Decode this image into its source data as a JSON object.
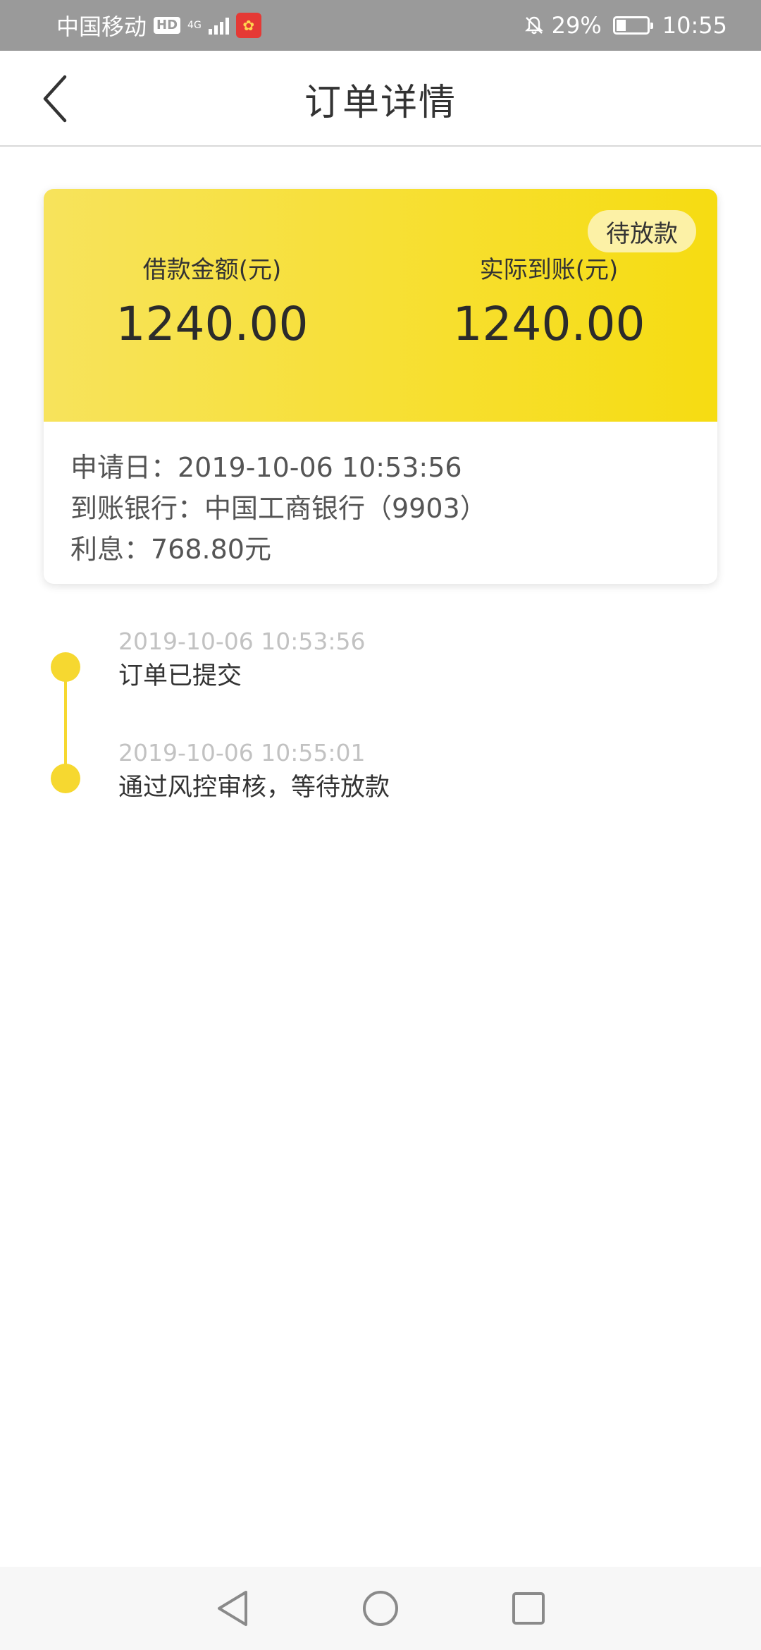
{
  "status_bar": {
    "carrier": "中国移动",
    "hd": "HD",
    "network": "4G",
    "battery_percent": "29%",
    "battery_level": 0.29,
    "time": "10:55"
  },
  "header": {
    "title": "订单详情"
  },
  "order_card": {
    "status_badge": "待放款",
    "loan_amount_label": "借款金额(元)",
    "loan_amount_value": "1240.00",
    "received_amount_label": "实际到账(元)",
    "received_amount_value": "1240.00",
    "apply_date": "申请日：2019-10-06 10:53:56",
    "bank": "到账银行：中国工商银行（9903）",
    "interest": "利息：768.80元"
  },
  "timeline": [
    {
      "time": "2019-10-06 10:53:56",
      "text": "订单已提交"
    },
    {
      "time": "2019-10-06 10:55:01",
      "text": "通过风控审核，等待放款"
    }
  ],
  "colors": {
    "accent": "#f6d830",
    "status_bar_bg": "#9a9a9a",
    "badge_bg": "#fcf1a6"
  },
  "icons": {
    "back": "chevron-left-icon",
    "nav_back": "triangle-back-icon",
    "nav_home": "circle-home-icon",
    "nav_recents": "square-recents-icon"
  }
}
